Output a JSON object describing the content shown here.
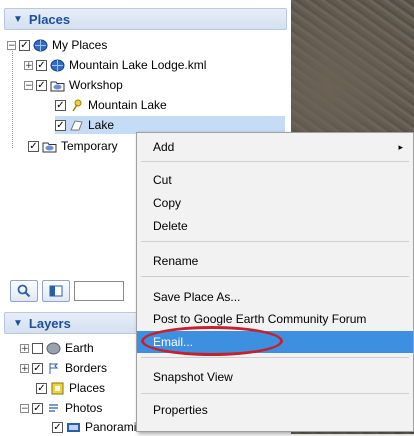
{
  "places": {
    "header": "Places",
    "items": [
      {
        "label": "My Places"
      },
      {
        "label": "Mountain Lake Lodge.kml"
      },
      {
        "label": "Workshop"
      },
      {
        "label": "Mountain Lake"
      },
      {
        "label": "Lake"
      },
      {
        "label": "Temporary"
      }
    ]
  },
  "layers": {
    "header": "Layers",
    "items": [
      {
        "label": "Earth"
      },
      {
        "label": "Borders"
      },
      {
        "label": "Places"
      },
      {
        "label": "Photos"
      },
      {
        "label": "Panoramio"
      }
    ]
  },
  "context_menu": {
    "items": [
      {
        "label": "Add",
        "has_submenu": true
      },
      {
        "label": "Cut"
      },
      {
        "label": "Copy"
      },
      {
        "label": "Delete"
      },
      {
        "label": "Rename"
      },
      {
        "label": "Save Place As..."
      },
      {
        "label": "Post to Google Earth Community Forum"
      },
      {
        "label": "Email...",
        "highlighted": true
      },
      {
        "label": "Snapshot View"
      },
      {
        "label": "Properties"
      }
    ],
    "submenu_arrow": "▸"
  },
  "colors": {
    "header_text": "#1d4f9c",
    "menu_highlight": "#3d8fe0",
    "annotation_circle": "#c8202a"
  },
  "icons": [
    "globe-icon",
    "folder-icon",
    "pushpin-icon",
    "polygon-icon",
    "search-icon",
    "panel-toggle-icon",
    "borders-icon",
    "photos-icon"
  ]
}
